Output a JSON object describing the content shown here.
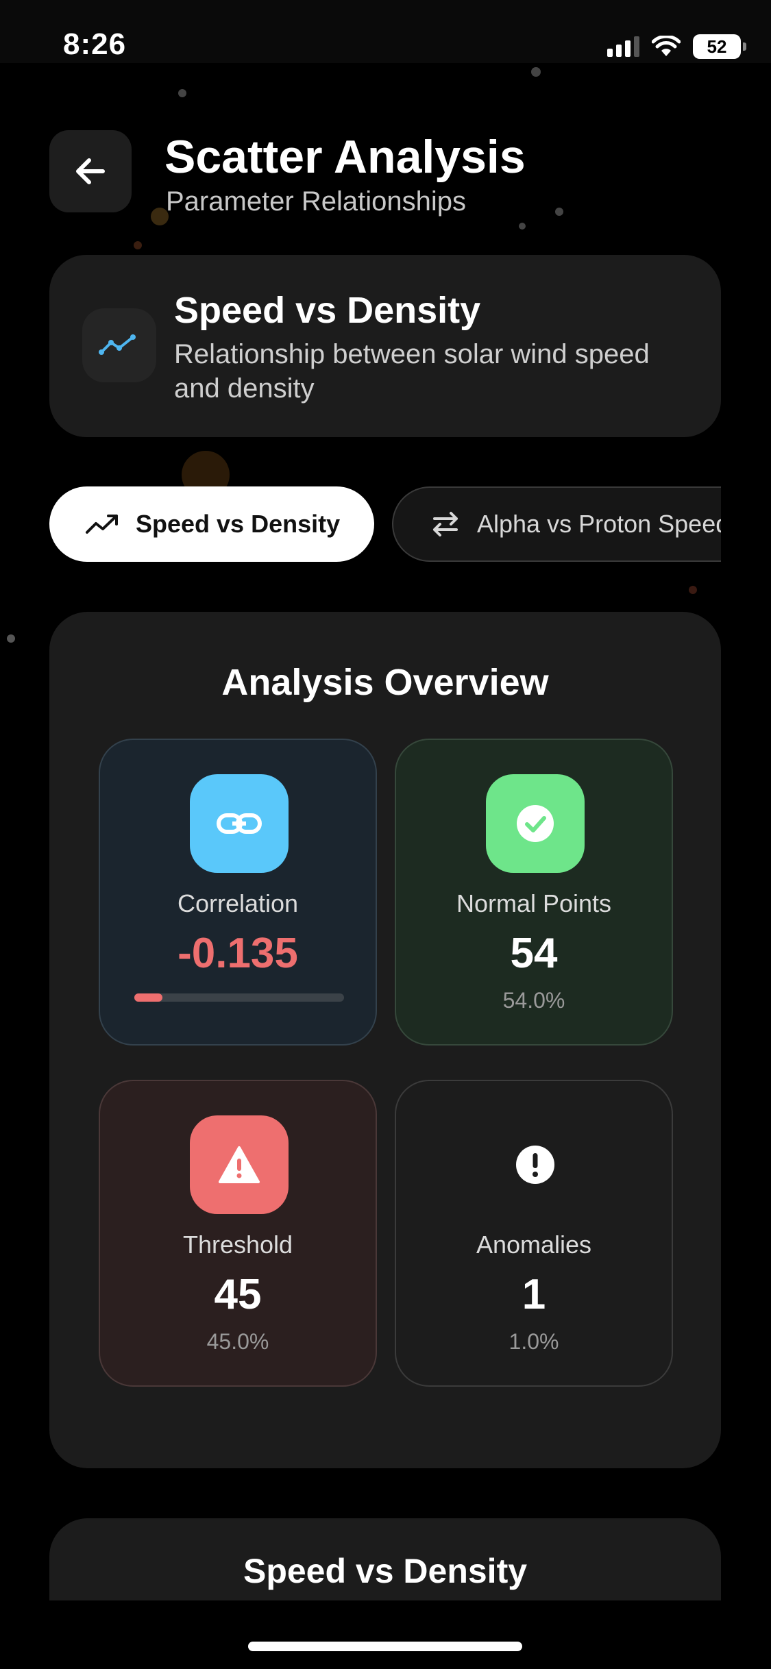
{
  "status_bar": {
    "time": "8:26",
    "battery": "52"
  },
  "header": {
    "title": "Scatter Analysis",
    "subtitle": "Parameter Relationships",
    "back_icon": "arrow-left-icon"
  },
  "info_card": {
    "icon": "trend-line-icon",
    "title": "Speed vs Density",
    "description": "Relationship between solar wind speed and density"
  },
  "tabs": [
    {
      "label": "Speed vs Density",
      "icon": "trending-up-icon",
      "active": true
    },
    {
      "label": "Alpha vs Proton Speed",
      "icon": "swap-arrows-icon",
      "active": false
    }
  ],
  "overview": {
    "title": "Analysis Overview",
    "stats": {
      "correlation": {
        "label": "Correlation",
        "value": "-0.135",
        "progress": 0.135,
        "icon": "link-icon",
        "value_color": "#ee6f6f"
      },
      "normal": {
        "label": "Normal Points",
        "value": "54",
        "sub": "54.0%",
        "icon": "check-circle-icon"
      },
      "threshold": {
        "label": "Threshold",
        "value": "45",
        "sub": "45.0%",
        "icon": "warning-triangle-icon"
      },
      "anomalies": {
        "label": "Anomalies",
        "value": "1",
        "sub": "1.0%",
        "icon": "exclamation-circle-icon"
      }
    }
  },
  "chart_card": {
    "title": "Speed vs Density"
  },
  "colors": {
    "accent_blue": "#5ac8fa",
    "accent_green": "#6ee58a",
    "accent_red": "#ee6f6f",
    "card_bg": "#1c1c1c"
  }
}
